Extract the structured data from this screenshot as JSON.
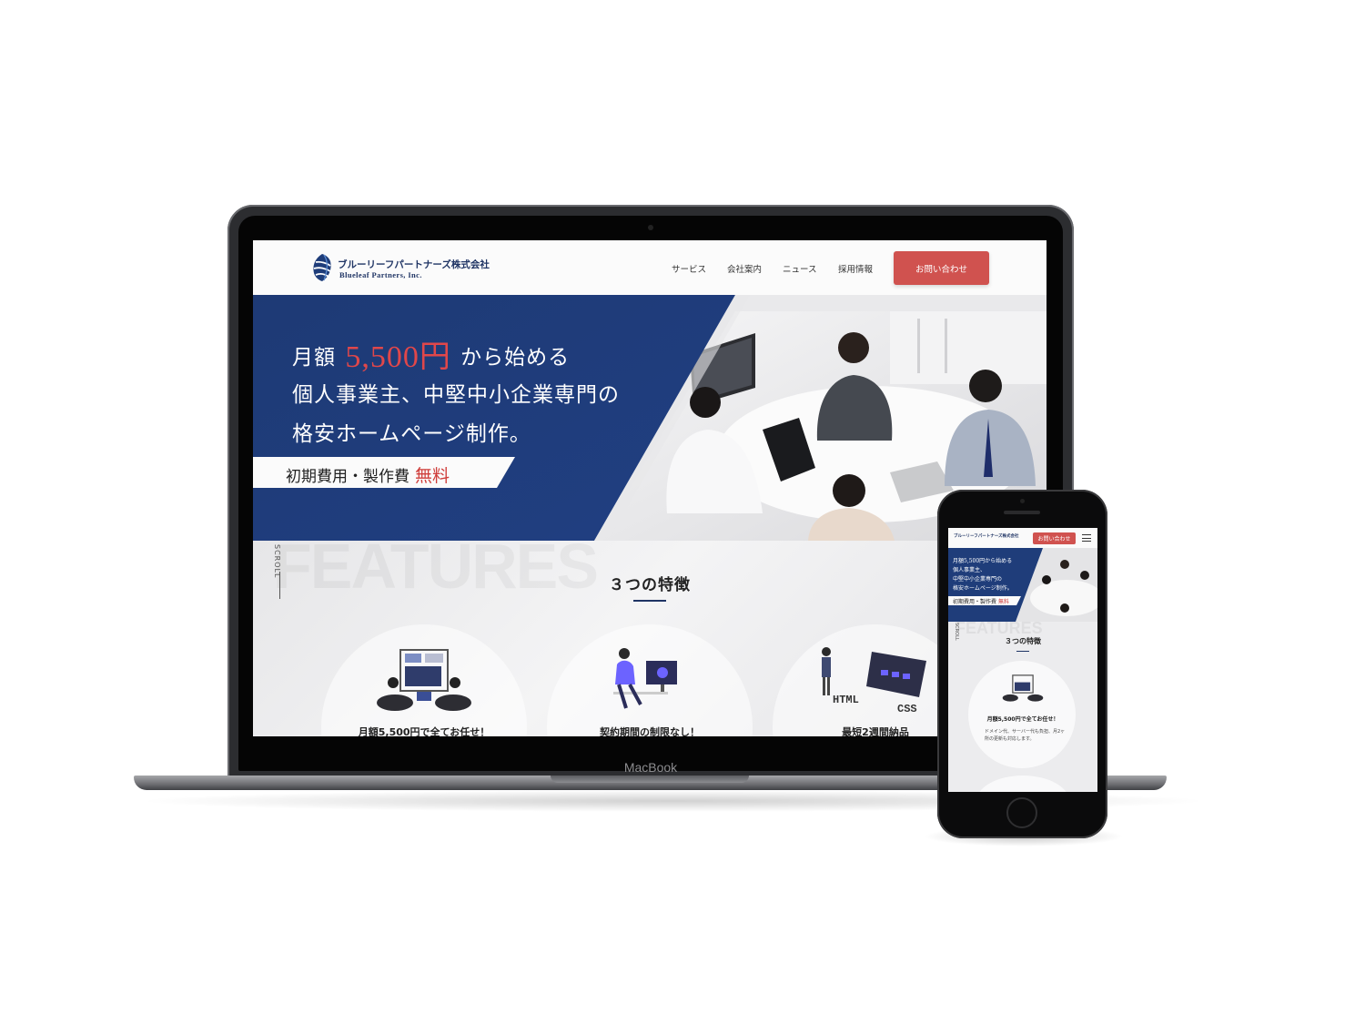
{
  "site": {
    "company_jp": "ブルーリーフパートナーズ株式会社",
    "company_en": "Blueleaf Partners, Inc.",
    "nav": [
      "サービス",
      "会社案内",
      "ニュース",
      "採用情報"
    ],
    "cta_label": "お問い合わせ",
    "hero": {
      "line1_prefix": "月額",
      "line1_price": "5,500円",
      "line1_suffix": "から始める",
      "line2": "個人事業主、中堅中小企業専門の",
      "line3": "格安ホームページ制作。",
      "ribbon_text": "初期費用・製作費",
      "ribbon_highlight": "無料"
    },
    "features": {
      "bg_word": "FEATURES",
      "scroll_label": "SCROLL",
      "title": "３つの特徴",
      "items": [
        {
          "caption": "月額5,500円で全てお任せ！"
        },
        {
          "caption": "契約期間の制限なし！"
        },
        {
          "caption": "最短2週間納品"
        }
      ],
      "illustration_labels": [
        "HTML",
        "CSS"
      ]
    }
  },
  "mobile": {
    "company_jp": "ブルーリーフパートナーズ株式会社",
    "cta_label": "お問い合わせ",
    "hero": {
      "line1": "月額5,500円から始める",
      "line2": "個人事業主、",
      "line3": "中堅中小企業専門の",
      "line4": "格安ホームページ制作。",
      "ribbon": "初期費用・製作費",
      "ribbon_highlight": "無料"
    },
    "features_title": "３つの特徴",
    "feature1_caption": "月額5,500円で全てお任せ！",
    "feature1_desc": "ドメイン代、サーバー代も負担、月2ヶ所の更新も対応します。"
  },
  "device": {
    "laptop_label": "MacBook"
  },
  "colors": {
    "navy": "#1f3d7a",
    "accent_red": "#d0524f",
    "price_red": "#e0474a"
  }
}
